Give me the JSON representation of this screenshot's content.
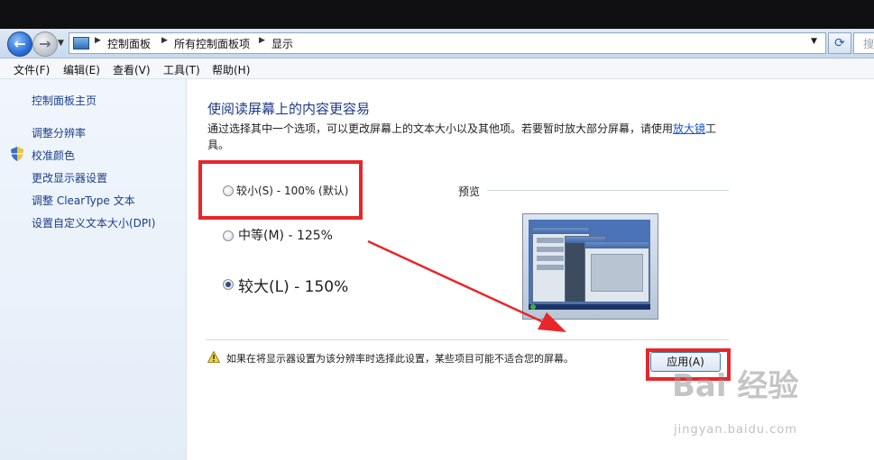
{
  "breadcrumb": {
    "items": [
      "控制面板",
      "所有控制面板项",
      "显示"
    ]
  },
  "search": {
    "placeholder": "搜"
  },
  "menu": {
    "items": [
      "文件(F)",
      "编辑(E)",
      "查看(V)",
      "工具(T)",
      "帮助(H)"
    ]
  },
  "sidebar": {
    "items": [
      "控制面板主页",
      "调整分辨率",
      "校准颜色",
      "更改显示器设置",
      "调整 ClearType 文本",
      "设置自定义文本大小(DPI)"
    ]
  },
  "main": {
    "heading": "使阅读屏幕上的内容更容易",
    "description": "通过选择其中一个选项，可以更改屏幕上的文本大小以及其他项。若要暂时放大部分屏幕，请使用",
    "magnifier_link": "放大镜",
    "description_tail": "工具。",
    "options": [
      {
        "label": "较小(S) - 100% (默认)",
        "selected": false
      },
      {
        "label": "中等(M) - 125%",
        "selected": false
      },
      {
        "label": "较大(L) - 150%",
        "selected": true
      }
    ],
    "preview_label": "预览",
    "warning": "如果在将显示器设置为该分辨率时选择此设置，某些项目可能不适合您的屏幕。",
    "apply_label": "应用(A)"
  },
  "watermark": {
    "brand": "Bai 经验",
    "url": "jingyan.baidu.com"
  },
  "colors": {
    "highlight_red": "#e8262a",
    "link_blue": "#1b55c9",
    "heading_blue": "#1e3a8a"
  }
}
